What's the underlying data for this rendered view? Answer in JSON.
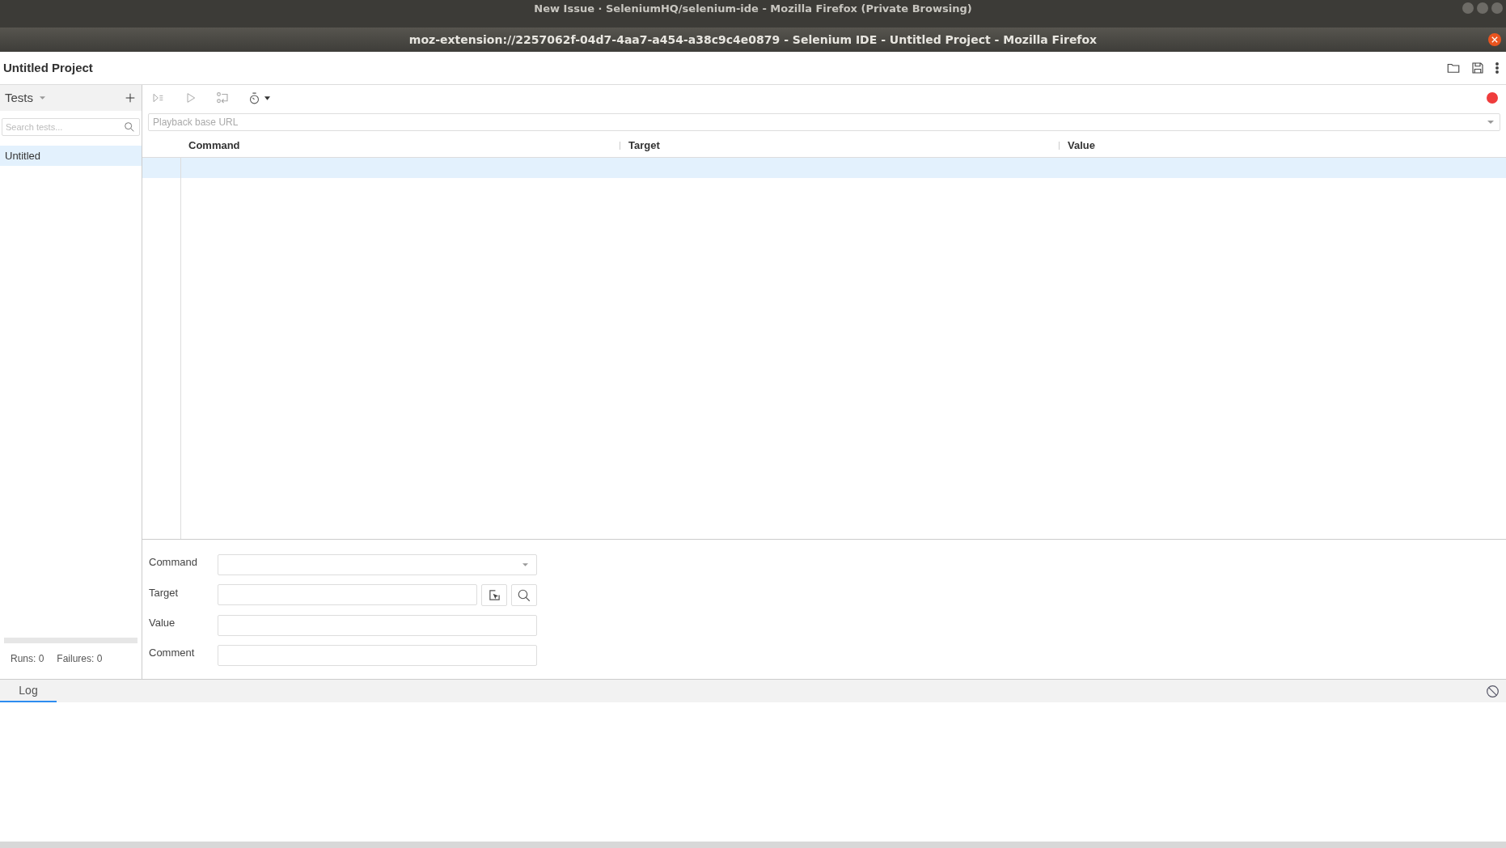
{
  "outer_window": {
    "title": "New Issue · SeleniumHQ/selenium-ide - Mozilla Firefox (Private Browsing)"
  },
  "window": {
    "title": "moz-extension://2257062f-04d7-4aa7-a454-a38c9c4e0879 - Selenium IDE - Untitled Project - Mozilla Firefox"
  },
  "project": {
    "name": "Untitled Project"
  },
  "sidebar": {
    "heading": "Tests",
    "search": {
      "placeholder": "Search tests..."
    },
    "tests": [
      {
        "name": "Untitled",
        "selected": true
      }
    ],
    "progress": {
      "level": 0
    },
    "runs": "Runs: 0",
    "failures": "Failures: 0"
  },
  "toolbar": {
    "recording": false
  },
  "url": {
    "placeholder": "Playback base URL"
  },
  "table": {
    "columns": [
      "Command",
      "Target",
      "Value"
    ],
    "rows": [
      {
        "selected": true
      }
    ]
  },
  "editor": {
    "fields": [
      {
        "label": "Command",
        "kind": "select"
      },
      {
        "label": "Target",
        "kind": "target"
      },
      {
        "label": "Value",
        "kind": "text"
      },
      {
        "label": "Comment",
        "kind": "text"
      }
    ]
  },
  "log": {
    "tabs": [
      {
        "label": "Log",
        "selected": true
      }
    ]
  }
}
